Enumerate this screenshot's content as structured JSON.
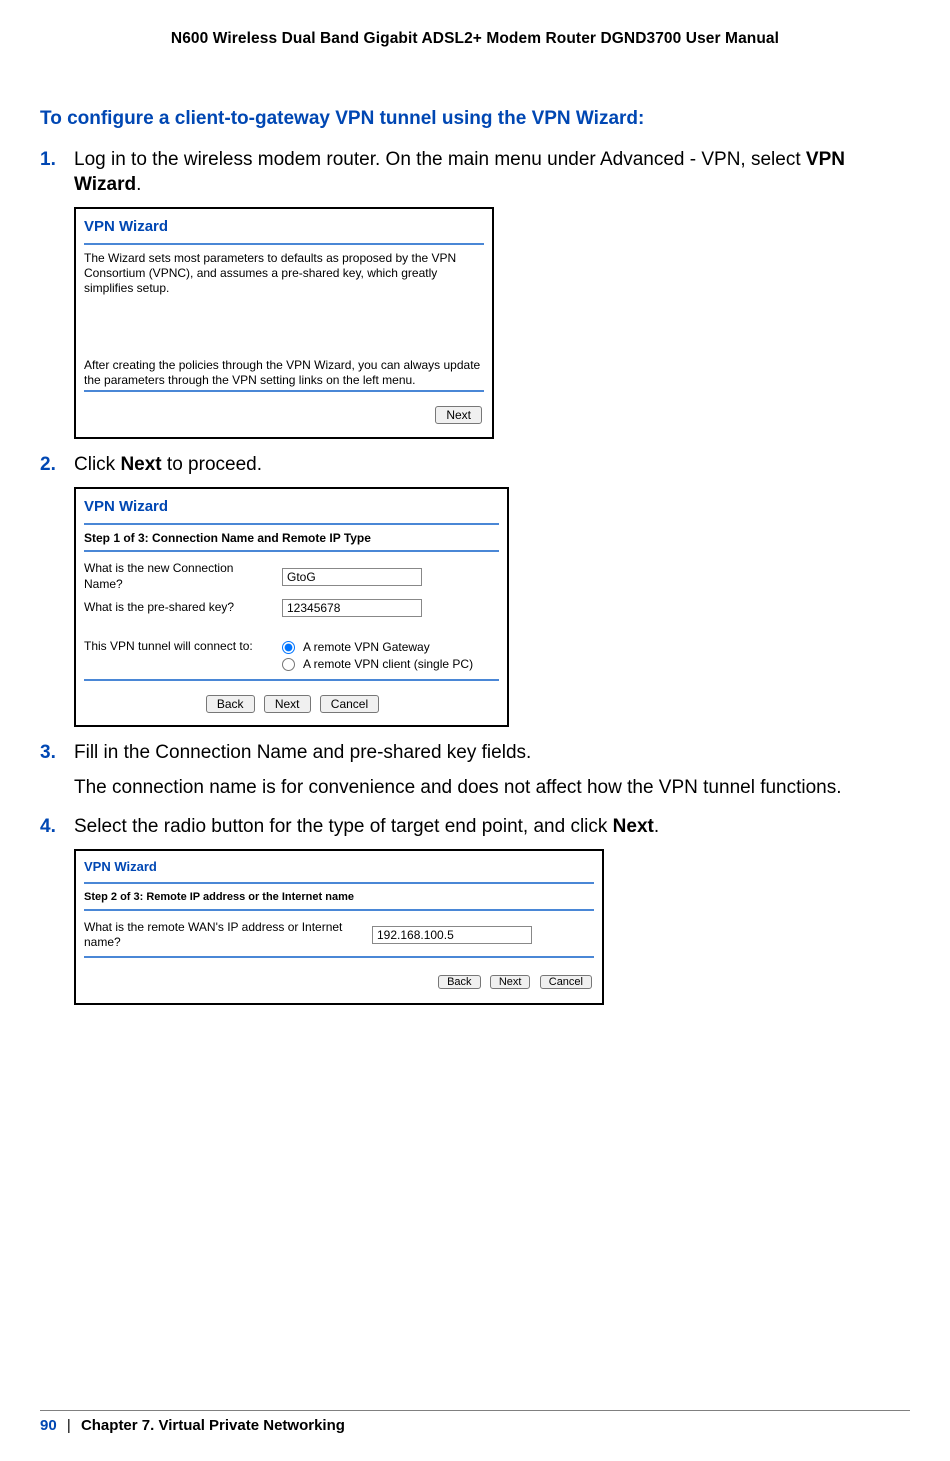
{
  "header": "N600 Wireless Dual Band Gigabit ADSL2+ Modem Router DGND3700 User Manual",
  "section_heading": "To configure a client-to-gateway VPN tunnel using the VPN Wizard:",
  "steps": {
    "s1": {
      "num": "1.",
      "text_a": "Log in to the wireless modem router. On the main menu under Advanced - VPN, select ",
      "bold": "VPN Wizard",
      "text_b": "."
    },
    "s2": {
      "num": "2.",
      "text_a": "Click ",
      "bold": "Next",
      "text_b": " to proceed."
    },
    "s3": {
      "num": "3.",
      "text": "Fill in the Connection Name and pre-shared key fields.",
      "para": "The connection name is for convenience and does not affect how the VPN tunnel functions."
    },
    "s4": {
      "num": "4.",
      "text_a": "Select the radio button for the type of target end point, and click ",
      "bold": "Next",
      "text_b": "."
    }
  },
  "shot1": {
    "title": "VPN Wizard",
    "p1": "The Wizard sets most parameters to defaults as proposed by the VPN Consortium (VPNC), and assumes a pre-shared key, which greatly simplifies setup.",
    "p2": "After creating the policies through the VPN Wizard, you can always update the parameters through the VPN setting links on the left menu.",
    "next": "Next"
  },
  "shot2": {
    "title": "VPN Wizard",
    "sub": "Step 1 of 3: Connection Name and Remote IP Type",
    "q1": "What is the new Connection Name?",
    "v1": "GtoG",
    "q2": "What is the pre-shared key?",
    "v2": "12345678",
    "q3": "This VPN tunnel will connect to:",
    "opt1": "A remote VPN Gateway",
    "opt2": "A remote VPN client (single PC)",
    "back": "Back",
    "next": "Next",
    "cancel": "Cancel"
  },
  "shot3": {
    "title": "VPN Wizard",
    "sub": "Step 2 of 3: Remote IP address or the Internet name",
    "q1": "What is the remote WAN's IP address or Internet name?",
    "v1": "192.168.100.5",
    "back": "Back",
    "next": "Next",
    "cancel": "Cancel"
  },
  "footer": {
    "page": "90",
    "bar": "|",
    "chapter": "Chapter 7.  Virtual Private Networking"
  }
}
